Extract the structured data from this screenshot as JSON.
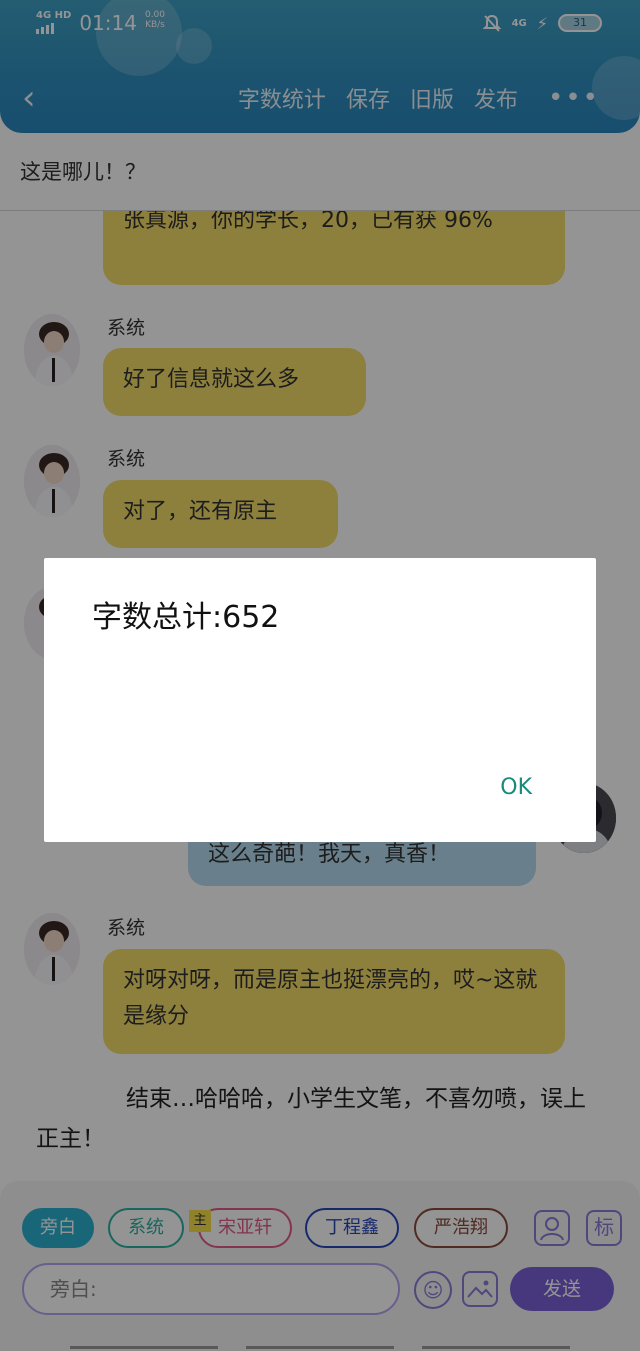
{
  "statusbar": {
    "network": "4G HD",
    "time": "01:14",
    "speed_value": "0.00",
    "speed_unit": "KB/s",
    "signal": "4G",
    "battery": "31"
  },
  "nav": {
    "back_icon": "chevron-left-icon",
    "items": [
      "字数统计",
      "保存",
      "旧版",
      "发布"
    ],
    "more": "•••"
  },
  "subtitle": "这是哪儿！？",
  "chat": {
    "messages": [
      {
        "speaker": "",
        "text": "张真源，你的学长，20，已有获 96%",
        "color": "#f3dc6a"
      },
      {
        "speaker": "系统",
        "text": "好了信息就这么多",
        "color": "#f3dc6a"
      },
      {
        "speaker": "系统",
        "text": "对了，还有原主",
        "color": "#f3dc6a"
      },
      {
        "speaker": "",
        "text": "这么奇葩！我天，真香！",
        "color": "#b6dcf2"
      },
      {
        "speaker": "系统",
        "text": "对呀对呀，而是原主也挺漂亮的，哎~这就是缘分",
        "color": "#f3dc6a"
      }
    ],
    "narration": "结束…哈哈哈，小学生文笔，不喜勿喷，误上正主！"
  },
  "dialog": {
    "message": "字数总计:652",
    "ok": "OK"
  },
  "panel": {
    "roles": [
      {
        "label": "旁白",
        "color": "#2bb0d0",
        "active": true
      },
      {
        "label": "系统",
        "color": "#2bb0a0",
        "active": false
      },
      {
        "label": "宋亚轩",
        "color": "#e05a8a",
        "active": false
      },
      {
        "label": "丁程鑫",
        "color": "#2a48b8",
        "active": false
      },
      {
        "label": "严浩翔",
        "color": "#8a4a3a",
        "active": false
      }
    ],
    "main_tag": "主",
    "side_icons": [
      "person-icon",
      "标"
    ],
    "input_placeholder": "旁白:",
    "emoji_icon": "smile-icon",
    "image_icon": "image-icon",
    "send": "发送"
  }
}
